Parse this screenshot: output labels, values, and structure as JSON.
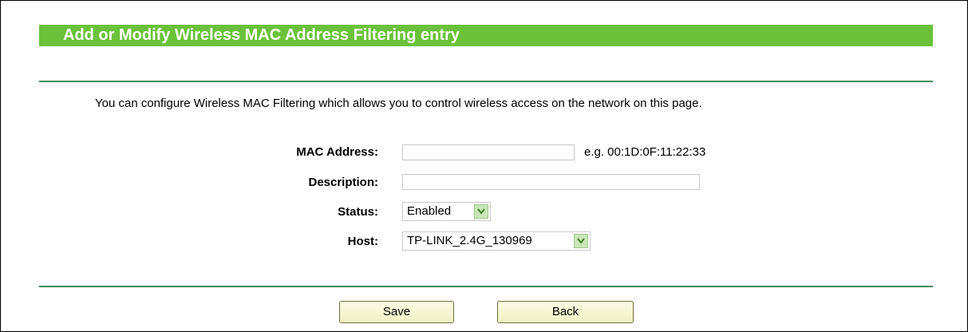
{
  "header": {
    "title": "Add or Modify Wireless MAC Address Filtering entry"
  },
  "description": "You can configure Wireless MAC Filtering which allows you to control wireless access on the network on this page.",
  "form": {
    "mac_address": {
      "label": "MAC Address:",
      "value": "",
      "hint": "e.g. 00:1D:0F:11:22:33"
    },
    "description": {
      "label": "Description:",
      "value": ""
    },
    "status": {
      "label": "Status:",
      "selected": "Enabled",
      "arrow_icon": "chevron-down-icon"
    },
    "host": {
      "label": "Host:",
      "selected": "TP-LINK_2.4G_130969",
      "arrow_icon": "chevron-down-icon"
    }
  },
  "buttons": {
    "save_label": "Save",
    "back_label": "Back"
  },
  "colors": {
    "title_bar": "#6bc23a",
    "title_text": "#ffffff",
    "divider": "#3e8e5a",
    "button_bg": "#f0f0c4",
    "select_arrow_bg": "#c9e6b6"
  }
}
